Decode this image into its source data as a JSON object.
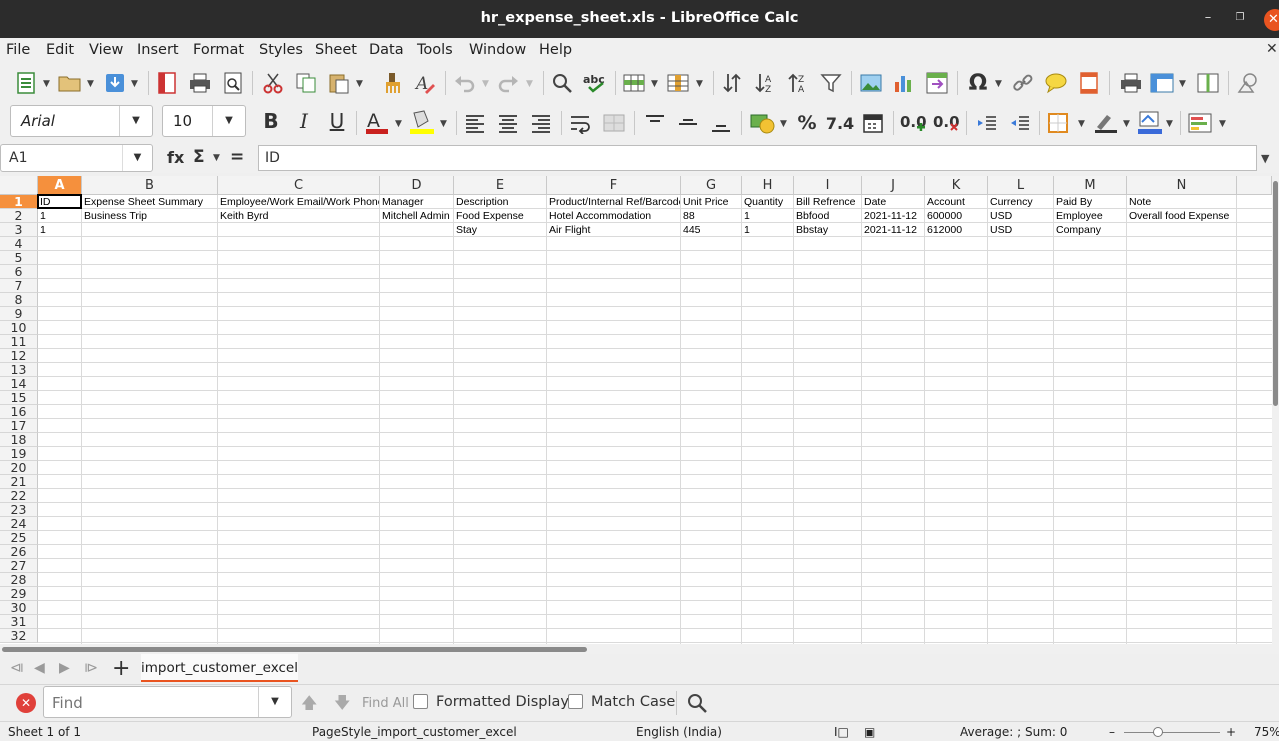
{
  "window": {
    "title": "hr_expense_sheet.xls - LibreOffice Calc"
  },
  "menu": [
    "File",
    "Edit",
    "View",
    "Insert",
    "Format",
    "Styles",
    "Sheet",
    "Data",
    "Tools",
    "Window",
    "Help"
  ],
  "format_toolbar": {
    "font_name": "Arial",
    "font_size": "10"
  },
  "formula_bar": {
    "cell_ref": "A1",
    "fx": "fx",
    "sigma": "Σ",
    "equals": "=",
    "content": "ID"
  },
  "grid": {
    "columns": [
      "A",
      "B",
      "C",
      "D",
      "E",
      "F",
      "G",
      "H",
      "I",
      "J",
      "K",
      "L",
      "M",
      "N"
    ],
    "selected_column": "A",
    "selected_row": "1",
    "row_numbers": [
      "1",
      "2",
      "3",
      "4",
      "5",
      "6",
      "7",
      "8",
      "9",
      "10",
      "11",
      "12",
      "13",
      "14",
      "15",
      "16",
      "17",
      "18",
      "19",
      "20",
      "21",
      "22",
      "23",
      "24",
      "25",
      "26",
      "27",
      "28",
      "29",
      "30",
      "31",
      "32"
    ],
    "rows": [
      [
        "ID",
        "Expense Sheet Summary",
        "Employee/Work Email/Work Phone",
        "Manager",
        "Description",
        "Product/Internal Ref/Barcode",
        "Unit Price",
        "Quantity",
        "Bill Refrence",
        "Date",
        "Account",
        "Currency",
        "Paid By",
        "Note"
      ],
      [
        "1",
        "Business Trip",
        "Keith Byrd",
        "Mitchell Admin",
        "Food Expense",
        "Hotel Accommodation",
        "88",
        "1",
        "Bbfood",
        "2021-11-12",
        "600000",
        "USD",
        "Employee",
        "Overall food Expense"
      ],
      [
        "1",
        "",
        "",
        "",
        "Stay",
        "Air Flight",
        "445",
        "1",
        "Bbstay",
        "2021-11-12",
        "612000",
        "USD",
        "Company",
        ""
      ]
    ]
  },
  "sheet_tabs": {
    "active": "import_customer_excel"
  },
  "find_bar": {
    "placeholder": "Find",
    "find_all": "Find All",
    "formatted_display": "Formatted Display",
    "match_case": "Match Case"
  },
  "status_bar": {
    "sheet": "Sheet 1 of 1",
    "page_style": "PageStyle_import_customer_excel",
    "language": "English (India)",
    "summary": "Average: ; Sum: 0",
    "zoom": "75%"
  }
}
